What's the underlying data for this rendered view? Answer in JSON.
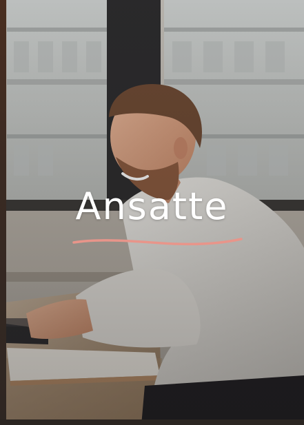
{
  "hero": {
    "title": "Ansatte",
    "underline_color": "#e8958a",
    "photo_icon": "man-at-laptop-photo"
  }
}
